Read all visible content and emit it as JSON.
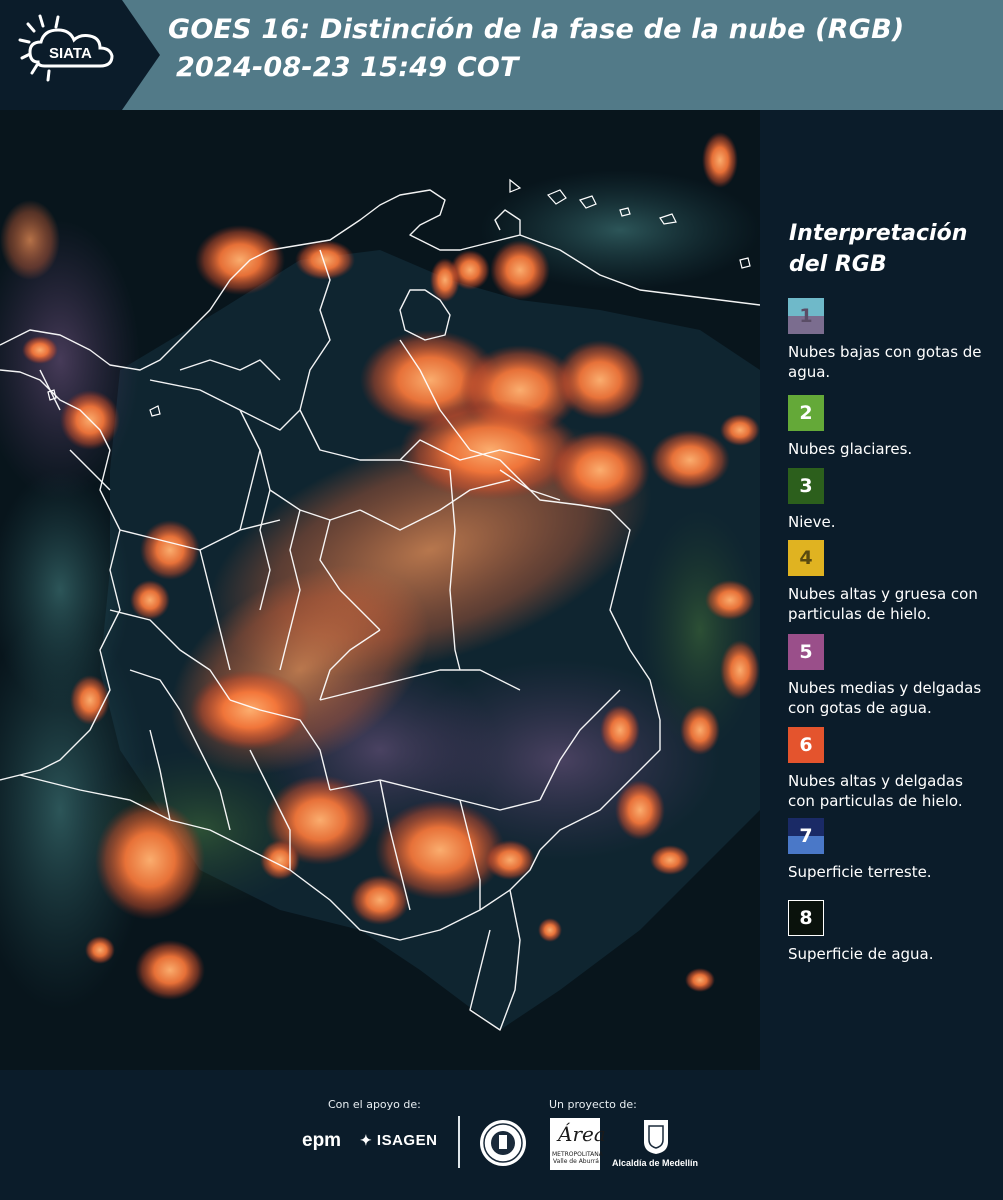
{
  "header": {
    "logo_text": "SIATA",
    "title_line1": "GOES 16: Distinción de la fase de la nube (RGB)",
    "title_line2": "2024-08-23 15:49 COT"
  },
  "map": {
    "description_icon": "satellite-rgb-map-colombia"
  },
  "legend": {
    "title_line1": "Interpretación",
    "title_line2": "del RGB",
    "items": [
      {
        "number": "1",
        "label": "Nubes bajas con gotas de agua.",
        "color_top": "#6fb9c9",
        "color_bottom": "#7b6d8f",
        "num_color": "#5a4d66"
      },
      {
        "number": "2",
        "label": "Nubes glaciares.",
        "color_top": "#64a938",
        "color_bottom": "#64a938",
        "num_color": "#ffffff"
      },
      {
        "number": "3",
        "label": "Nieve.",
        "color_top": "#2c5f1c",
        "color_bottom": "#2c5f1c",
        "num_color": "#ffffff"
      },
      {
        "number": "4",
        "label": "Nubes altas y gruesa con particulas de hielo.",
        "color_top": "#e0b321",
        "color_bottom": "#e0b321",
        "num_color": "#5a4a10"
      },
      {
        "number": "5",
        "label": "Nubes medias y delgadas con gotas de agua.",
        "color_top": "#9a4f8a",
        "color_bottom": "#9a4f8a",
        "num_color": "#ffffff"
      },
      {
        "number": "6",
        "label": "Nubes altas y delgadas con particulas de hielo.",
        "color_top": "#e4542d",
        "color_bottom": "#e4542d",
        "num_color": "#ffffff"
      },
      {
        "number": "7",
        "label": "Superficie terreste.",
        "color_top": "#1a2a66",
        "color_bottom": "#4a78c8",
        "num_color": "#ffffff"
      },
      {
        "number": "8",
        "label": "Superficie de agua.",
        "color_top": "#0a120c",
        "color_bottom": "#0a120c",
        "num_color": "#ffffff"
      }
    ]
  },
  "footer": {
    "support_label": "Con el apoyo de:",
    "project_label": "Un proyecto de:",
    "sponsor_epm": "epm",
    "sponsor_isagen": "ISAGEN",
    "metro_logo_script": "Área",
    "metro_logo_small": "METROPOLITANA Valle de Aburrá",
    "alcaldia_label": "Alcaldía de Medellín"
  }
}
